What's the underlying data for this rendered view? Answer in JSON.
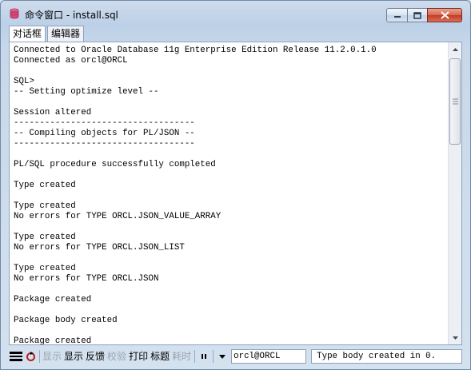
{
  "window": {
    "title": "命令窗口 - install.sql",
    "accent_close": "#c23b22"
  },
  "tabs": [
    {
      "label": "对话框",
      "active": true
    },
    {
      "label": "编辑器",
      "active": false
    }
  ],
  "output_lines": [
    "Connected to Oracle Database 11g Enterprise Edition Release 11.2.0.1.0",
    "Connected as orcl@ORCL",
    "",
    "SQL>",
    "-- Setting optimize level --",
    "",
    "Session altered",
    "-----------------------------------",
    "-- Compiling objects for PL/JSON --",
    "-----------------------------------",
    "",
    "PL/SQL procedure successfully completed",
    "",
    "Type created",
    "",
    "Type created",
    "No errors for TYPE ORCL.JSON_VALUE_ARRAY",
    "",
    "Type created",
    "No errors for TYPE ORCL.JSON_LIST",
    "",
    "Type created",
    "No errors for TYPE ORCL.JSON",
    "",
    "Package created",
    "",
    "Package body created",
    "",
    "Package created"
  ],
  "statusbar": {
    "buttons": [
      {
        "label": "显示",
        "disabled": true
      },
      {
        "label": "显示",
        "disabled": false
      },
      {
        "label": "反馈",
        "disabled": false
      },
      {
        "label": "校验",
        "disabled": true
      },
      {
        "label": "打印",
        "disabled": false
      },
      {
        "label": "标题",
        "disabled": false
      },
      {
        "label": "耗时",
        "disabled": true
      }
    ],
    "connection": "orcl@ORCL",
    "message": "Type body created in 0.",
    "icons": [
      "output-lines-icon",
      "refresh-icon",
      "pause-icon",
      "dropdown-arrow-icon"
    ]
  }
}
